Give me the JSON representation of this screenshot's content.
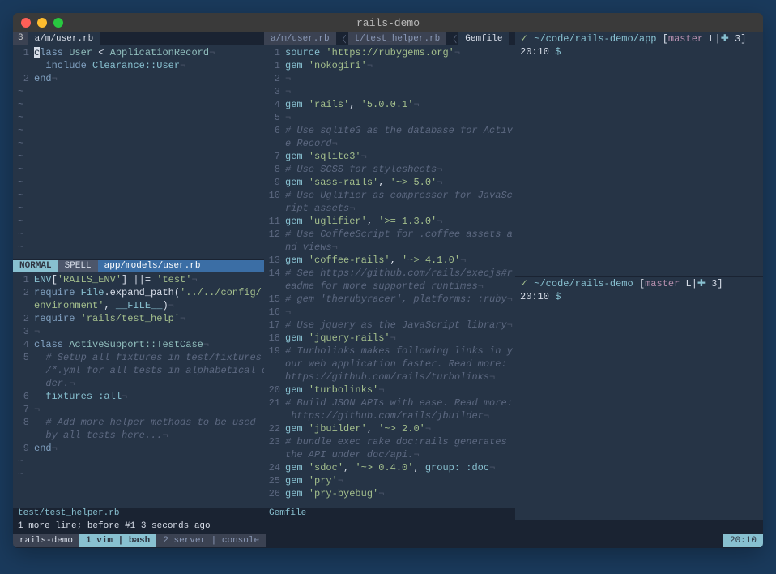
{
  "window": {
    "title": "rails-demo"
  },
  "left": {
    "tabs": {
      "count": "3",
      "path": "a/m/user.rb"
    },
    "top": {
      "lines": [
        {
          "n": "1",
          "html": "<span class='cursor-char'>c</span><span class='kw'>lass</span> <span class='cls'>User</span> < <span class='cls'>ApplicationRecord</span><span class='eol'>¬</span>"
        },
        {
          "n": "",
          "html": "  <span class='kw'>include</span> <span class='const'>Clearance::User</span><span class='eol'>¬</span>"
        },
        {
          "n": "2",
          "html": "<span class='kw'>end</span><span class='eol'>¬</span>"
        }
      ]
    },
    "mode": {
      "normal": "NORMAL",
      "spell": "SPELL",
      "path": "app/models/user.rb"
    },
    "bottom": {
      "lines": [
        {
          "n": "1",
          "html": "<span class='const'>ENV</span>[<span class='str'>'RAILS_ENV'</span>] ||= <span class='str'>'test'</span><span class='eol'>¬</span>"
        },
        {
          "n": "2",
          "html": "<span class='kw'>require</span> <span class='const'>File</span>.expand_path(<span class='str'>'../../config/</span>"
        },
        {
          "n": "",
          "html": "<span class='str'>environment'</span>, <span class='const'>__FILE__</span>)<span class='eol'>¬</span>"
        },
        {
          "n": "2",
          "html": "<span class='kw'>require</span> <span class='str'>'rails/test_help'</span><span class='eol'>¬</span>"
        },
        {
          "n": "3",
          "html": "<span class='eol'>¬</span>"
        },
        {
          "n": "4",
          "html": "<span class='kw'>class</span> <span class='cls'>ActiveSupport::TestCase</span><span class='eol'>¬</span>"
        },
        {
          "n": "5",
          "html": "  <span class='cmt'># Setup all fixtures in test/fixtures</span>"
        },
        {
          "n": "",
          "html": "  <span class='cmt'>/*.yml for all tests in alphabetical or</span>"
        },
        {
          "n": "",
          "html": "  <span class='cmt'>der.</span><span class='eol'>¬</span>"
        },
        {
          "n": "6",
          "html": "  <span class='const'>fixtures</span> <span class='sym'>:all</span><span class='eol'>¬</span>"
        },
        {
          "n": "7",
          "html": "<span class='eol'>¬</span>"
        },
        {
          "n": "8",
          "html": "  <span class='cmt'># Add more helper methods to be used</span>"
        },
        {
          "n": "",
          "html": "  <span class='cmt'>by all tests here...</span><span class='eol'>¬</span>"
        },
        {
          "n": "9",
          "html": "<span class='kw'>end</span><span class='eol'>¬</span>"
        }
      ],
      "filename": "test/test_helper.rb"
    }
  },
  "mid": {
    "tabs": [
      {
        "label": "a/m/user.rb",
        "active": false
      },
      {
        "label": "t/test_helper.rb",
        "active": false
      },
      {
        "label": "Gemfile",
        "active": true
      }
    ],
    "lines": [
      {
        "n": "1",
        "html": "<span class='const'>source</span> <span class='str'>'https://rubygems.org'</span><span class='eol'>¬</span>"
      },
      {
        "n": "1",
        "html": "<span class='const'>gem</span> <span class='str'>'nokogiri'</span><span class='eol'>¬</span>"
      },
      {
        "n": "2",
        "html": "<span class='eol'>¬</span>"
      },
      {
        "n": "3",
        "html": "<span class='eol'>¬</span>"
      },
      {
        "n": "4",
        "html": "<span class='const'>gem</span> <span class='str'>'rails'</span>, <span class='str'>'5.0.0.1'</span><span class='eol'>¬</span>"
      },
      {
        "n": "5",
        "html": "<span class='eol'>¬</span>"
      },
      {
        "n": "6",
        "html": "<span class='cmt'># Use sqlite3 as the database for Activ</span>"
      },
      {
        "n": "",
        "html": "<span class='cmt'>e Record</span><span class='eol'>¬</span>"
      },
      {
        "n": "7",
        "html": "<span class='const'>gem</span> <span class='str'>'sqlite3'</span><span class='eol'>¬</span>"
      },
      {
        "n": "8",
        "html": "<span class='cmt'># Use SCSS for stylesheets</span><span class='eol'>¬</span>"
      },
      {
        "n": "9",
        "html": "<span class='const'>gem</span> <span class='str'>'sass-rails'</span>, <span class='str'>'~> 5.0'</span><span class='eol'>¬</span>"
      },
      {
        "n": "10",
        "html": "<span class='cmt'># Use Uglifier as compressor for JavaSc</span>"
      },
      {
        "n": "",
        "html": "<span class='cmt'>ript assets</span><span class='eol'>¬</span>"
      },
      {
        "n": "11",
        "html": "<span class='const'>gem</span> <span class='str'>'uglifier'</span>, <span class='str'>'>= 1.3.0'</span><span class='eol'>¬</span>"
      },
      {
        "n": "12",
        "html": "<span class='cmt'># Use CoffeeScript for .coffee assets a</span>"
      },
      {
        "n": "",
        "html": "<span class='cmt'>nd views</span><span class='eol'>¬</span>"
      },
      {
        "n": "13",
        "html": "<span class='const'>gem</span> <span class='str'>'coffee-rails'</span>, <span class='str'>'~> 4.1.0'</span><span class='eol'>¬</span>"
      },
      {
        "n": "14",
        "html": "<span class='cmt'># See https://github.com/rails/execjs#r</span>"
      },
      {
        "n": "",
        "html": "<span class='cmt'>eadme for more supported runtimes</span><span class='eol'>¬</span>"
      },
      {
        "n": "15",
        "html": "<span class='cmt'># gem 'therubyracer', platforms: :ruby</span><span class='eol'>¬</span>"
      },
      {
        "n": "16",
        "html": "<span class='eol'>¬</span>"
      },
      {
        "n": "17",
        "html": "<span class='cmt'># Use jquery as the JavaScript library</span><span class='eol'>¬</span>"
      },
      {
        "n": "18",
        "html": "<span class='const'>gem</span> <span class='str'>'jquery-rails'</span><span class='eol'>¬</span>"
      },
      {
        "n": "19",
        "html": "<span class='cmt'># Turbolinks makes following links in y</span>"
      },
      {
        "n": "",
        "html": "<span class='cmt'>our web application faster. Read more:</span>"
      },
      {
        "n": "",
        "html": "<span class='cmt'>https://github.com/rails/turbolinks</span><span class='eol'>¬</span>"
      },
      {
        "n": "20",
        "html": "<span class='const'>gem</span> <span class='str'>'turbolinks'</span><span class='eol'>¬</span>"
      },
      {
        "n": "21",
        "html": "<span class='cmt'># Build JSON APIs with ease. Read more:</span>"
      },
      {
        "n": "",
        "html": "<span class='cmt'> https://github.com/rails/jbuilder</span><span class='eol'>¬</span>"
      },
      {
        "n": "22",
        "html": "<span class='const'>gem</span> <span class='str'>'jbuilder'</span>, <span class='str'>'~> 2.0'</span><span class='eol'>¬</span>"
      },
      {
        "n": "23",
        "html": "<span class='cmt'># bundle exec rake doc:rails generates</span>"
      },
      {
        "n": "",
        "html": "<span class='cmt'>the API under doc/api.</span><span class='eol'>¬</span>"
      },
      {
        "n": "24",
        "html": "<span class='const'>gem</span> <span class='str'>'sdoc'</span>, <span class='str'>'~> 0.4.0'</span>, <span class='sym'>group:</span> <span class='sym'>:doc</span><span class='eol'>¬</span>"
      },
      {
        "n": "25",
        "html": "<span class='const'>gem</span> <span class='str'>'pry'</span><span class='eol'>¬</span>"
      },
      {
        "n": "26",
        "html": "<span class='const'>gem</span> <span class='str'>'pry-byebug'</span><span class='eol'>¬</span>"
      }
    ],
    "filename": "Gemfile"
  },
  "right": {
    "top": {
      "check": "✓",
      "path": "~/code/rails-demo/app",
      "branch_open": "[",
      "branch": "master",
      "branch_sep": " L|",
      "plus": "✚",
      "count": " 3",
      "branch_close": "]",
      "time": "20:10",
      "dollar": "$"
    },
    "bottom": {
      "check": "✓",
      "path": "~/code/rails-demo",
      "branch_open": "[",
      "branch": "master",
      "branch_sep": " L|",
      "plus": "✚",
      "count": " 3",
      "branch_close": "]",
      "time": "20:10",
      "dollar": "$"
    }
  },
  "message": "1 more line; before #1  3 seconds ago",
  "tmux": {
    "session": "rails-demo",
    "win1_idx": "1",
    "win1": "vim | bash",
    "win2_idx": "2",
    "win2": "server | console",
    "time": "20:10"
  }
}
